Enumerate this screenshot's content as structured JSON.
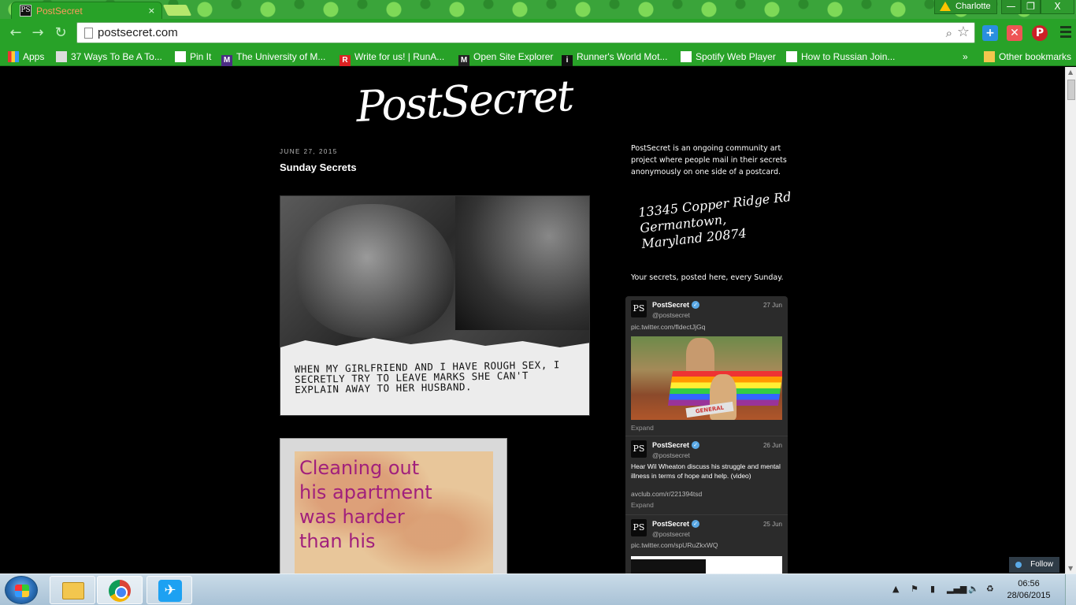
{
  "browser": {
    "tab_title": "PostSecret",
    "tab_close": "×",
    "profile_name": "Charlotte",
    "url": "postsecret.com",
    "window_controls": {
      "minimize": "—",
      "maximize": "❐",
      "close": "X"
    }
  },
  "bookmarks": {
    "apps": "Apps",
    "items": [
      "37 Ways To Be A To...",
      "Pin It",
      "The University of M...",
      "Write for us! | RunA...",
      "Open Site Explorer",
      "Runner's World Mot...",
      "Spotify Web Player",
      "How to Russian Join..."
    ],
    "overflow": "»",
    "other": "Other bookmarks"
  },
  "page": {
    "logo": "PostSecret",
    "post_date": "JUNE 27, 2015",
    "post_title": "Sunday Secrets",
    "postcard1_text": "WHEN MY GIRLFRIEND AND I HAVE ROUGH SEX, I SECRETLY TRY TO LEAVE MARKS SHE CAN'T EXPLAIN AWAY TO HER HUSBAND.",
    "postcard2_lines": [
      "Cleaning out",
      "his apartment",
      "was harder",
      "than his"
    ],
    "sidebar_intro": "PostSecret is an ongoing community art project where people mail in their secrets anonymously on one side of a postcard.",
    "address_lines": [
      "13345 Copper Ridge Rd",
      "Germantown,",
      "Maryland 20874"
    ],
    "sidebar_sundays": "Your secrets, posted here, every Sunday."
  },
  "twitter": {
    "tweets": [
      {
        "name": "PostSecret",
        "handle": "@postsecret",
        "date": "27 Jun",
        "link": "pic.twitter.com/fIdectJjGq",
        "expand": "Expand",
        "image_label": "GENERAL"
      },
      {
        "name": "PostSecret",
        "handle": "@postsecret",
        "date": "26 Jun",
        "text": "Hear Wil Wheaton discuss his struggle and mental illness in terms of hope and help. (video)",
        "link": "avclub.com/r/221394tsd",
        "expand": "Expand"
      },
      {
        "name": "PostSecret",
        "handle": "@postsecret",
        "date": "25 Jun",
        "link": "pic.twitter.com/spURuZkxWQ"
      }
    ],
    "follow_label": "Follow"
  },
  "taskbar": {
    "time": "06:56",
    "date": "28/06/2015"
  }
}
